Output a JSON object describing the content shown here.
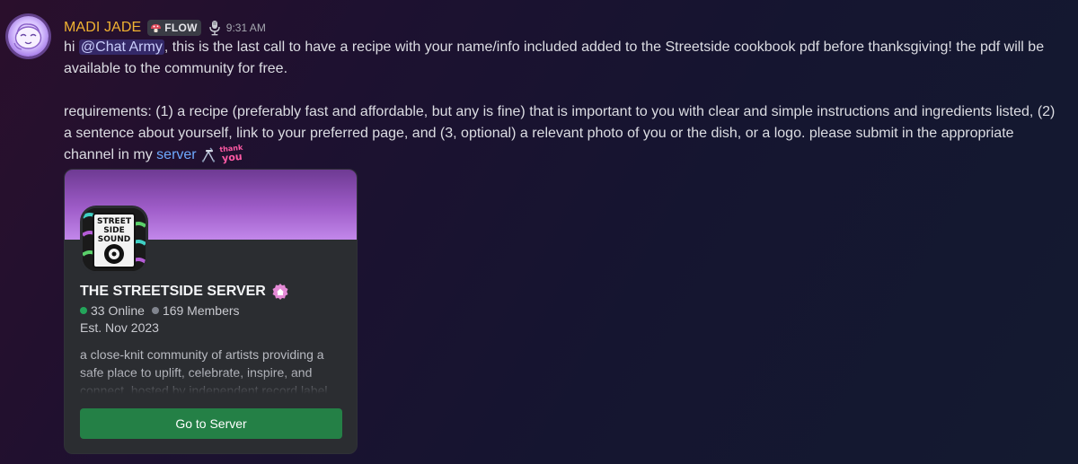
{
  "message": {
    "author": "MADI JADE",
    "tag_label": "FLOW",
    "timestamp": "9:31 AM",
    "author_color": "#f0b232",
    "p1_pre": "hi ",
    "mention": "@Chat Army",
    "p1_post": ", this is the last call to have a recipe with your name/info included added to the Streetside cookbook pdf before thanksgiving! the pdf will be available to the community for free.",
    "p2_pre": "requirements: (1) a recipe (preferably fast and affordable, but any is fine) that is important to you with clear and simple instructions and ingredients listed, (2) a sentence about yourself, link to your preferred page, and (3, optional) a relevant photo of you or the dish, or a logo. please submit in the appropriate channel in my ",
    "link_text": "server",
    "sticker_top": "thank",
    "sticker_bottom": "you",
    "icons": [
      "avatar",
      "mushroom-tag-icon",
      "microphone-role-icon",
      "walker-emoji",
      "thank-you-emoji"
    ]
  },
  "invite": {
    "server_name": "THE STREETSIDE SERVER",
    "online": "33 Online",
    "members": "169 Members",
    "established": "Est. Nov 2023",
    "description": "a close-knit community of artists providing a safe place to uplift, celebrate, inspire, and connect. hosted by independent record label",
    "button_label": "Go to Server",
    "logo_line1": "STREET",
    "logo_line2": "SIDE",
    "logo_line3": "SOUND",
    "button_color": "#248046",
    "online_color": "#23a55a"
  }
}
